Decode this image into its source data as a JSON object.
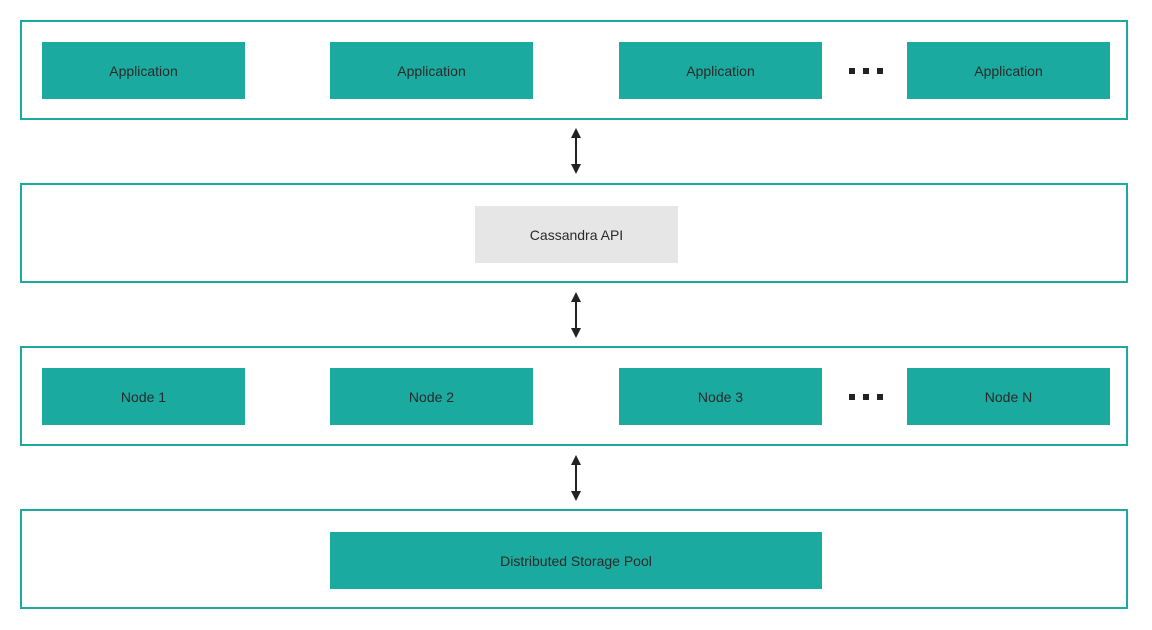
{
  "diagram": {
    "applications_layer": {
      "items": [
        "Application",
        "Application",
        "Application",
        "Application"
      ],
      "ellipsis": "more-items"
    },
    "api_layer": {
      "label": "Cassandra API"
    },
    "nodes_layer": {
      "items": [
        "Node 1",
        "Node 2",
        "Node 3",
        "Node N"
      ],
      "ellipsis": "more-items"
    },
    "storage_layer": {
      "label": "Distributed Storage Pool"
    },
    "colors": {
      "accent": "#1aaa9f",
      "api_fill": "#e6e6e6",
      "text": "#2a2a2a",
      "arrow": "#222222"
    }
  }
}
